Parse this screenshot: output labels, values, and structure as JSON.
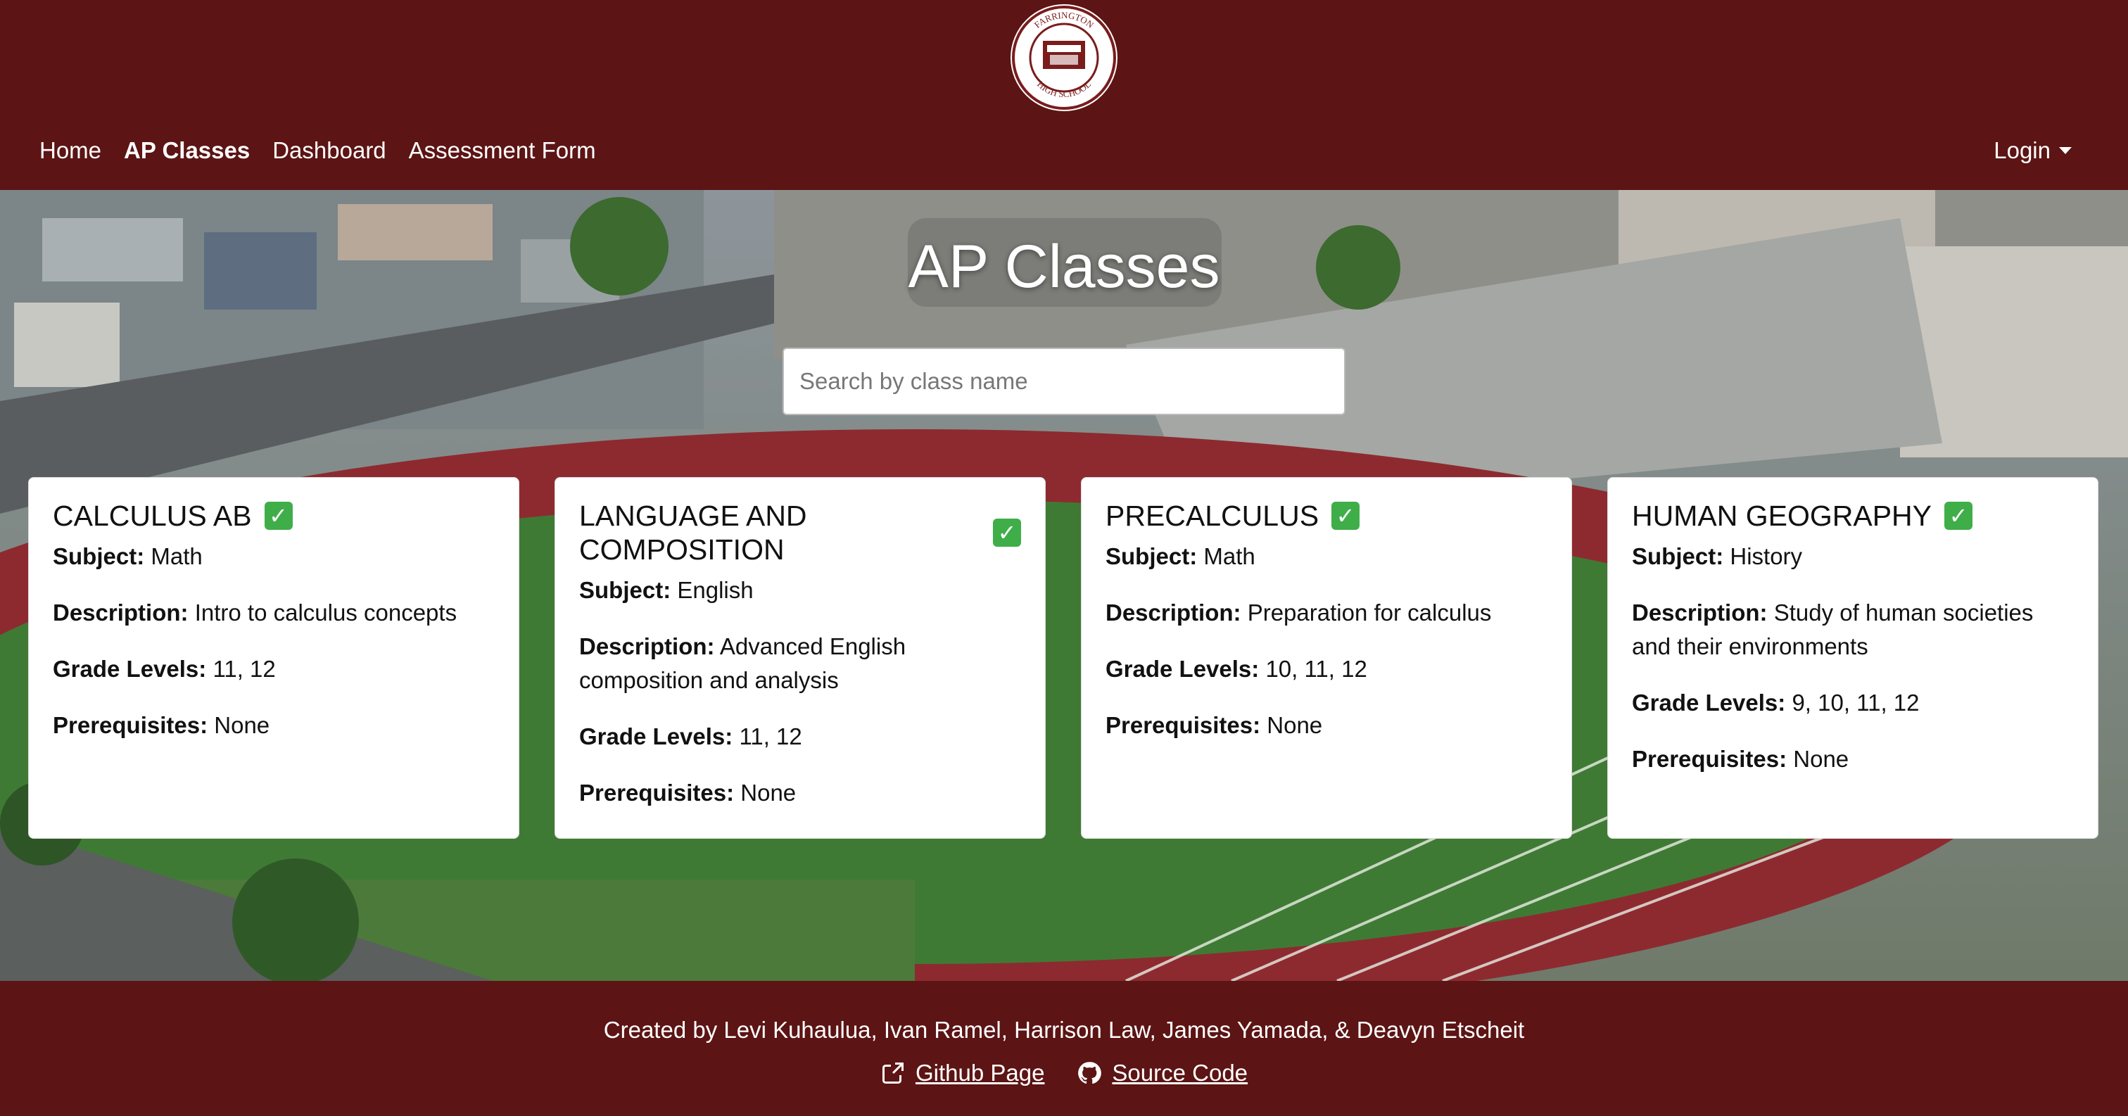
{
  "nav": {
    "logo_text": "FARRINGTON HIGH SCHOOL",
    "links": [
      "Home",
      "AP Classes",
      "Dashboard",
      "Assessment Form"
    ],
    "login_label": "Login"
  },
  "hero": {
    "title": "AP Classes",
    "search_placeholder": "Search by class name"
  },
  "cards": [
    {
      "title": "CALCULUS AB",
      "subject_label": "Subject:",
      "subject": "Math",
      "description_label": "Description:",
      "description": "Intro to calculus concepts",
      "grades_label": "Grade Levels:",
      "grades": "11, 12",
      "prereq_label": "Prerequisites:",
      "prereq": "None"
    },
    {
      "title": "LANGUAGE AND COMPOSITION",
      "subject_label": "Subject:",
      "subject": "English",
      "description_label": "Description:",
      "description": "Advanced English composition and analysis",
      "grades_label": "Grade Levels:",
      "grades": "11, 12",
      "prereq_label": "Prerequisites:",
      "prereq": "None"
    },
    {
      "title": "PRECALCULUS",
      "subject_label": "Subject:",
      "subject": "Math",
      "description_label": "Description:",
      "description": "Preparation for calculus",
      "grades_label": "Grade Levels:",
      "grades": "10, 11, 12",
      "prereq_label": "Prerequisites:",
      "prereq": "None"
    },
    {
      "title": "HUMAN GEOGRAPHY",
      "subject_label": "Subject:",
      "subject": "History",
      "description_label": "Description:",
      "description": "Study of human societies and their environments",
      "grades_label": "Grade Levels:",
      "grades": "9, 10, 11, 12",
      "prereq_label": "Prerequisites:",
      "prereq": "None"
    }
  ],
  "footer": {
    "credits": "Created by Levi Kuhaulua, Ivan Ramel, Harrison Law, James Yamada, & Deavyn Etscheit",
    "github_page": "Github Page",
    "source_code": "Source Code"
  },
  "colors": {
    "brand_maroon": "#5c1414",
    "check_green": "#3fae49"
  },
  "icons": [
    "school-logo-icon",
    "caret-down-icon",
    "checkmark-icon",
    "external-link-icon",
    "github-icon"
  ]
}
